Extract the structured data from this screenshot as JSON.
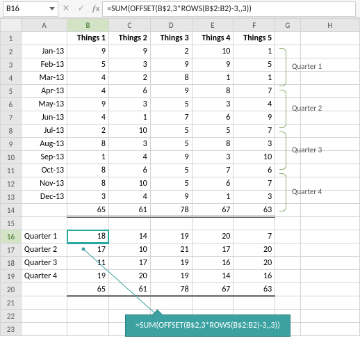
{
  "formula_bar": {
    "cell_ref": "B16",
    "formula": "=SUM(OFFSET(B$2,3*ROWS(B$2:B2)-3,,3))"
  },
  "columns": [
    "A",
    "B",
    "C",
    "D",
    "E",
    "F",
    "G",
    "H"
  ],
  "headers": {
    "B": "Things 1",
    "C": "Things 2",
    "D": "Things 3",
    "E": "Things 4",
    "F": "Things 5"
  },
  "rows": {
    "2": {
      "A": "Jan-13",
      "B": 9,
      "C": 9,
      "D": 2,
      "E": 10,
      "F": 1
    },
    "3": {
      "A": "Feb-13",
      "B": 5,
      "C": 3,
      "D": 9,
      "E": 9,
      "F": 5
    },
    "4": {
      "A": "Mar-13",
      "B": 4,
      "C": 2,
      "D": 8,
      "E": 1,
      "F": 1
    },
    "5": {
      "A": "Apr-13",
      "B": 4,
      "C": 6,
      "D": 9,
      "E": 8,
      "F": 7
    },
    "6": {
      "A": "May-13",
      "B": 9,
      "C": 3,
      "D": 5,
      "E": 3,
      "F": 4
    },
    "7": {
      "A": "Jun-13",
      "B": 4,
      "C": 1,
      "D": 7,
      "E": 6,
      "F": 9
    },
    "8": {
      "A": "Jul-13",
      "B": 2,
      "C": 10,
      "D": 5,
      "E": 5,
      "F": 7
    },
    "9": {
      "A": "Aug-13",
      "B": 8,
      "C": 3,
      "D": 5,
      "E": 8,
      "F": 3
    },
    "10": {
      "A": "Sep-13",
      "B": 1,
      "C": 4,
      "D": 9,
      "E": 3,
      "F": 10
    },
    "11": {
      "A": "Oct-13",
      "B": 8,
      "C": 6,
      "D": 5,
      "E": 7,
      "F": 6
    },
    "12": {
      "A": "Nov-13",
      "B": 8,
      "C": 10,
      "D": 5,
      "E": 6,
      "F": 7
    },
    "13": {
      "A": "Dec-13",
      "B": 3,
      "C": 4,
      "D": 9,
      "E": 1,
      "F": 3
    },
    "14": {
      "B": 65,
      "C": 61,
      "D": 78,
      "E": 67,
      "F": 63
    },
    "16": {
      "A": "Quarter 1",
      "B": 18,
      "C": 14,
      "D": 19,
      "E": 20,
      "F": 7
    },
    "17": {
      "A": "Quarter 2",
      "B": 17,
      "C": 10,
      "D": 21,
      "E": 17,
      "F": 20
    },
    "18": {
      "A": "Quarter 3",
      "B": 11,
      "C": 17,
      "D": 19,
      "E": 16,
      "F": 20
    },
    "19": {
      "A": "Quarter 4",
      "B": 19,
      "C": 20,
      "D": 19,
      "E": 14,
      "F": 16
    },
    "20": {
      "B": 65,
      "C": 61,
      "D": 78,
      "E": 67,
      "F": 63
    }
  },
  "brackets": {
    "q1": "Quarter 1",
    "q2": "Quarter 2",
    "q3": "Quarter 3",
    "q4": "Quarter 4"
  },
  "callout": "=SUM(OFFSET(B$2,3*ROWS(B$2:B2)-3,,3))"
}
